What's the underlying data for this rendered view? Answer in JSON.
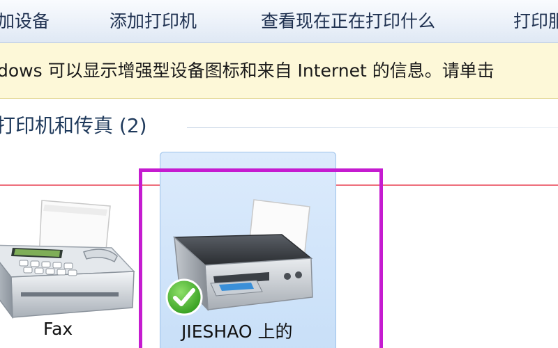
{
  "toolbar": {
    "add_device": "加设备",
    "add_printer": "添加打印机",
    "see_printing": "查看现在正在打印什么",
    "print_server": "打印服"
  },
  "infobar": {
    "text": "dows 可以显示增强型设备图标和来自 Internet 的信息。请单击"
  },
  "group": {
    "title": "打印机和传真 (2)"
  },
  "devices": [
    {
      "label": "Fax",
      "icon": "fax-machine-icon"
    },
    {
      "label": "JIESHAO 上的",
      "icon": "printer-icon",
      "status": "default-checkmark"
    }
  ],
  "colors": {
    "highlight_box": "#c51bd0",
    "annotation_line": "#ee6f7c",
    "selected_tile": "#c8dff8",
    "info_bar": "#fdf8d8"
  }
}
